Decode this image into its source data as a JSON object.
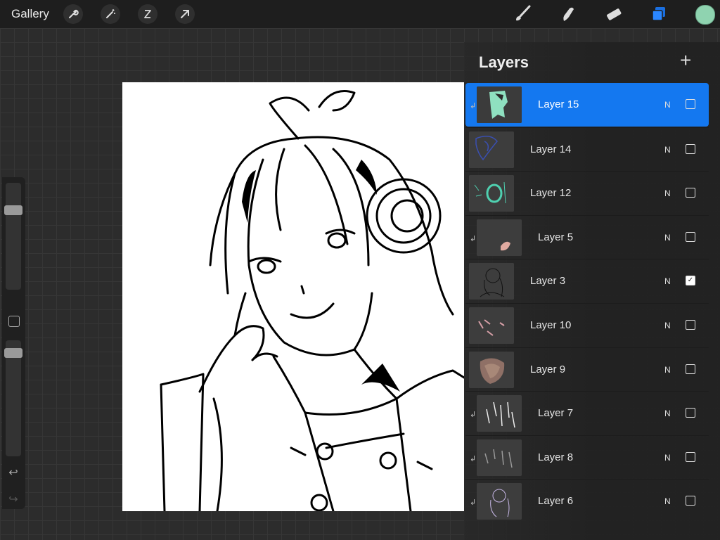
{
  "toolbar": {
    "gallery_label": "Gallery",
    "left_tools": [
      {
        "icon": "wrench-icon",
        "glyph": "🔧"
      },
      {
        "icon": "magic-wand-icon",
        "glyph": "✧"
      },
      {
        "icon": "selection-icon",
        "glyph": "S"
      },
      {
        "icon": "transform-arrow-icon",
        "glyph": "➚"
      }
    ],
    "right_tools": [
      "brush-icon",
      "smudge-icon",
      "eraser-icon",
      "layers-icon"
    ],
    "active_tool": "layers-icon",
    "color_swatch": "#8fd3b0",
    "accent": "#1478f0"
  },
  "sidebar": {
    "brush_size_fraction": 0.77,
    "opacity_fraction": 0.93,
    "undo_icon": "↩",
    "redo_icon": "↪"
  },
  "layers_panel": {
    "title": "Layers",
    "add_icon": "+",
    "layers": [
      {
        "name": "Layer 15",
        "blend": "N",
        "visible": false,
        "clipped": true,
        "active": true,
        "thumb": "green-brush"
      },
      {
        "name": "Layer 14",
        "blend": "N",
        "visible": false,
        "clipped": false,
        "active": false,
        "thumb": "blue-sketch"
      },
      {
        "name": "Layer 12",
        "blend": "N",
        "visible": false,
        "clipped": false,
        "active": false,
        "thumb": "teal-ring"
      },
      {
        "name": "Layer 5",
        "blend": "N",
        "visible": false,
        "clipped": true,
        "active": false,
        "thumb": "skin-patch"
      },
      {
        "name": "Layer 3",
        "blend": "N",
        "visible": true,
        "clipped": false,
        "active": false,
        "thumb": "lineart"
      },
      {
        "name": "Layer 10",
        "blend": "N",
        "visible": false,
        "clipped": false,
        "active": false,
        "thumb": "pink-marks"
      },
      {
        "name": "Layer 9",
        "blend": "N",
        "visible": false,
        "clipped": false,
        "active": false,
        "thumb": "skin-blob"
      },
      {
        "name": "Layer 7",
        "blend": "N",
        "visible": false,
        "clipped": true,
        "active": false,
        "thumb": "white-highlights"
      },
      {
        "name": "Layer 8",
        "blend": "N",
        "visible": false,
        "clipped": true,
        "active": false,
        "thumb": "gray-highlights"
      },
      {
        "name": "Layer 6",
        "blend": "N",
        "visible": false,
        "clipped": true,
        "active": false,
        "thumb": "purple-sketch"
      }
    ]
  }
}
